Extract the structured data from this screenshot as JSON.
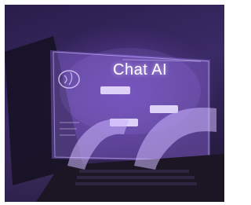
{
  "image": {
    "hologram_title": "Chat AI"
  },
  "colors": {
    "background_dark": "#2a1d4a",
    "hologram_glow": "#c7a8ff",
    "hologram_panel": "#7a5ac8"
  }
}
